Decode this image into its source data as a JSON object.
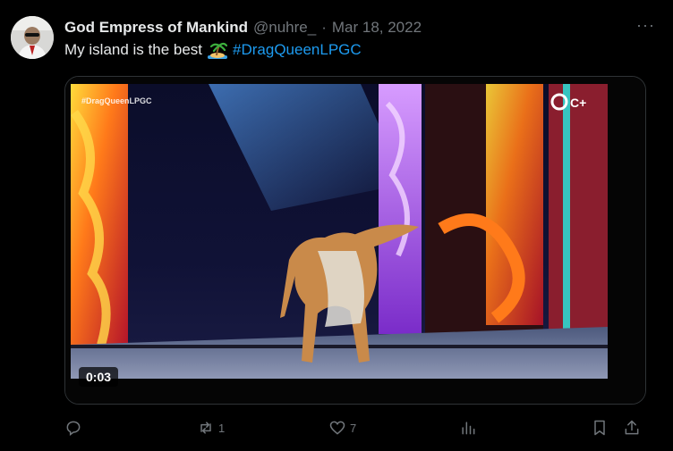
{
  "tweet": {
    "display_name": "God Empress of Mankind",
    "handle": "@nuhre_",
    "separator": "·",
    "date": "Mar 18, 2022",
    "more": "···",
    "text": "My island is the best",
    "emoji": "island-emoji",
    "hashtag": "#DragQueenLPGC"
  },
  "media": {
    "watermark": "#DragQueenLPGC",
    "duration": "0:03",
    "channel_logo": "C+"
  },
  "actions": {
    "reply_count": "",
    "retweet_count": "1",
    "like_count": "7",
    "views_count": ""
  },
  "colors": {
    "background": "#000000",
    "text": "#e7e9ea",
    "muted": "#71767b",
    "link": "#1d9bf0",
    "border": "#2f3336"
  }
}
